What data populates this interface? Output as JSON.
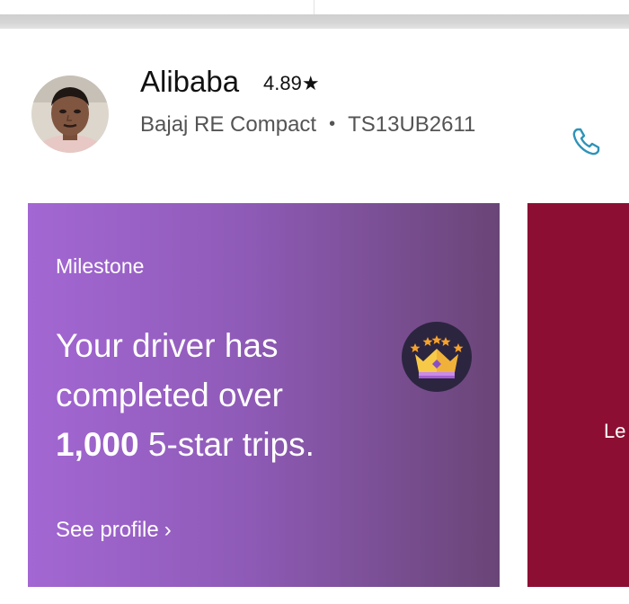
{
  "driver": {
    "name": "Alibaba",
    "rating": "4.89",
    "rating_star": "★",
    "vehicle": "Bajaj RE Compact",
    "separator": "•",
    "plate": "TS13UB2611",
    "call_icon": "phone-icon"
  },
  "milestone_card": {
    "eyebrow": "Milestone",
    "line1": "Your driver has",
    "line2": "completed over",
    "count": "1,000",
    "tail": "5-star trips.",
    "badge_icon": "crown-icon",
    "cta_label": "See profile",
    "cta_chevron": "›",
    "background_start": "#a367d3",
    "background_end": "#6a4577"
  },
  "second_card": {
    "label": "Le",
    "background": "#8c0f33"
  },
  "colors": {
    "accent_teal": "#2e93b8",
    "secondary_text": "#545454"
  }
}
